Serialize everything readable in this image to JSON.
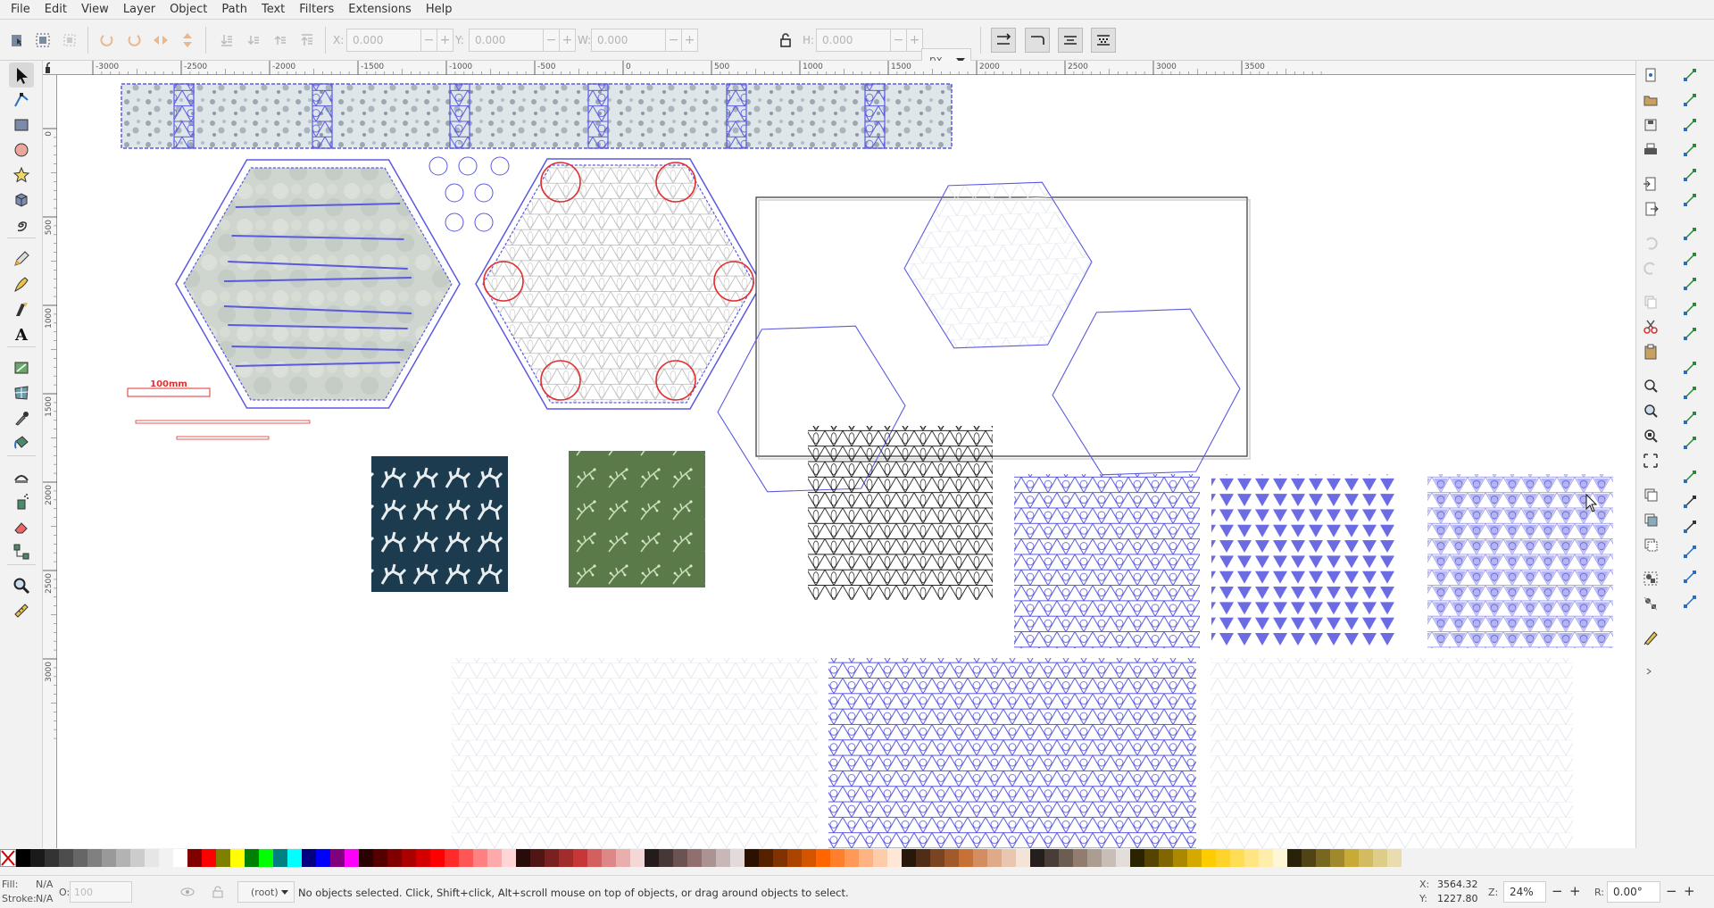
{
  "menu": [
    "File",
    "Edit",
    "View",
    "Layer",
    "Object",
    "Path",
    "Text",
    "Filters",
    "Extensions",
    "Help"
  ],
  "toolbar": {
    "x_label": "X:",
    "x_value": "0.000",
    "y_label": "Y:",
    "y_value": "0.000",
    "w_label": "W:",
    "w_value": "0.000",
    "h_label": "H:",
    "h_value": "0.000",
    "units": "px",
    "colors": {
      "icon": "#555555",
      "disabled": "#c8c8c8",
      "accent_orange": "#e8a35a"
    }
  },
  "ruler": {
    "h_ticks": [
      "-3000",
      "-2500",
      "-2000",
      "-1500",
      "-1000",
      "-500",
      "0",
      "500",
      "1000",
      "1500",
      "2000",
      "2500",
      "3000",
      "3500"
    ],
    "v_ticks": [
      "0",
      "500",
      "1000",
      "1500",
      "2000",
      "2500",
      "3000"
    ]
  },
  "tools": [
    {
      "name": "selector-tool",
      "icon": "arrow-icon"
    },
    {
      "name": "node-tool",
      "icon": "node-icon"
    },
    {
      "name": "rectangle-tool",
      "icon": "rect-icon"
    },
    {
      "name": "ellipse-tool",
      "icon": "circle-icon"
    },
    {
      "name": "star-tool",
      "icon": "star-icon"
    },
    {
      "name": "3dbox-tool",
      "icon": "box-icon"
    },
    {
      "name": "spiral-tool",
      "icon": "spiral-icon"
    },
    {
      "name": "pencil-tool",
      "icon": "pencil-icon"
    },
    {
      "name": "pen-tool",
      "icon": "pen-icon"
    },
    {
      "name": "calligraphy-tool",
      "icon": "calligraphy-icon"
    },
    {
      "name": "text-tool",
      "icon": "text-icon"
    },
    {
      "name": "gradient-tool",
      "icon": "gradient-icon"
    },
    {
      "name": "mesh-tool",
      "icon": "mesh-icon"
    },
    {
      "name": "dropper-tool",
      "icon": "dropper-icon"
    },
    {
      "name": "paint-bucket-tool",
      "icon": "bucket-icon"
    },
    {
      "name": "tweak-tool",
      "icon": "tweak-icon"
    },
    {
      "name": "spray-tool",
      "icon": "spray-icon"
    },
    {
      "name": "eraser-tool",
      "icon": "eraser-icon"
    },
    {
      "name": "connector-tool",
      "icon": "connector-icon"
    },
    {
      "name": "zoom-tool",
      "icon": "zoom-icon"
    },
    {
      "name": "measure-tool",
      "icon": "measure-icon"
    }
  ],
  "canvas": {
    "scale_label": "100mm",
    "colors": {
      "blue": "#5a5ae0",
      "red": "#e03030",
      "dark_teal": "#1d3b4f",
      "green": "#5a7a4a",
      "gray_tile": "#cfd8dc"
    }
  },
  "status": {
    "fill_label": "Fill:",
    "fill_value": "N/A",
    "stroke_label": "Stroke:",
    "stroke_value": "N/A",
    "opacity_label": "O:",
    "opacity_value": "100",
    "layer": "(root)",
    "message": "No objects selected. Click, Shift+click, Alt+scroll mouse on top of objects, or drag around objects to select.",
    "x_label": "X:",
    "x_value": "3564.32",
    "y_label": "Y:",
    "y_value": "1227.80",
    "zoom_label": "Z:",
    "zoom_value": "24%",
    "rot_label": "R:",
    "rot_value": "0.00°"
  },
  "palette": [
    "#000000",
    "#1a1a1a",
    "#333333",
    "#4d4d4d",
    "#666666",
    "#808080",
    "#999999",
    "#b3b3b3",
    "#cccccc",
    "#e6e6e6",
    "#f2f2f2",
    "#ffffff",
    "#800000",
    "#ff0000",
    "#808000",
    "#ffff00",
    "#008000",
    "#00ff00",
    "#008080",
    "#00ffff",
    "#000080",
    "#0000ff",
    "#800080",
    "#ff00ff",
    "#2b0000",
    "#550000",
    "#800000",
    "#aa0000",
    "#d40000",
    "#ff0000",
    "#ff2a2a",
    "#ff5555",
    "#ff8080",
    "#ffaaaa",
    "#ffd5d5",
    "#280b0b",
    "#501616",
    "#782121",
    "#a02c2c",
    "#c83737",
    "#d35f5f",
    "#de8787",
    "#e9afaf",
    "#f4d7d7",
    "#241c1c",
    "#483737",
    "#6c5353",
    "#916f6f",
    "#ac9393",
    "#c8b7b7",
    "#e3dbdb",
    "#2b1100",
    "#552200",
    "#803300",
    "#aa4400",
    "#d45500",
    "#ff6600",
    "#ff7f2a",
    "#ff9955",
    "#ffb380",
    "#ffccaa",
    "#ffe6d5",
    "#28170b",
    "#502d16",
    "#784421",
    "#a05a2c",
    "#c87137",
    "#d38d5f",
    "#deaa87",
    "#e9c6af",
    "#f4e3d7",
    "#241f1c",
    "#483e37",
    "#6c5d53",
    "#917c6f",
    "#ac9d93",
    "#c8beb7",
    "#e3dedb",
    "#2b2200",
    "#554400",
    "#806600",
    "#aa8800",
    "#d4aa00",
    "#ffcc00",
    "#ffd42a",
    "#ffdd55",
    "#ffe680",
    "#ffeeaa",
    "#fff6d5",
    "#28220b",
    "#504416",
    "#786721",
    "#a0892c",
    "#c8ab37",
    "#d3bc5f",
    "#decd87",
    "#e9ddaf"
  ]
}
